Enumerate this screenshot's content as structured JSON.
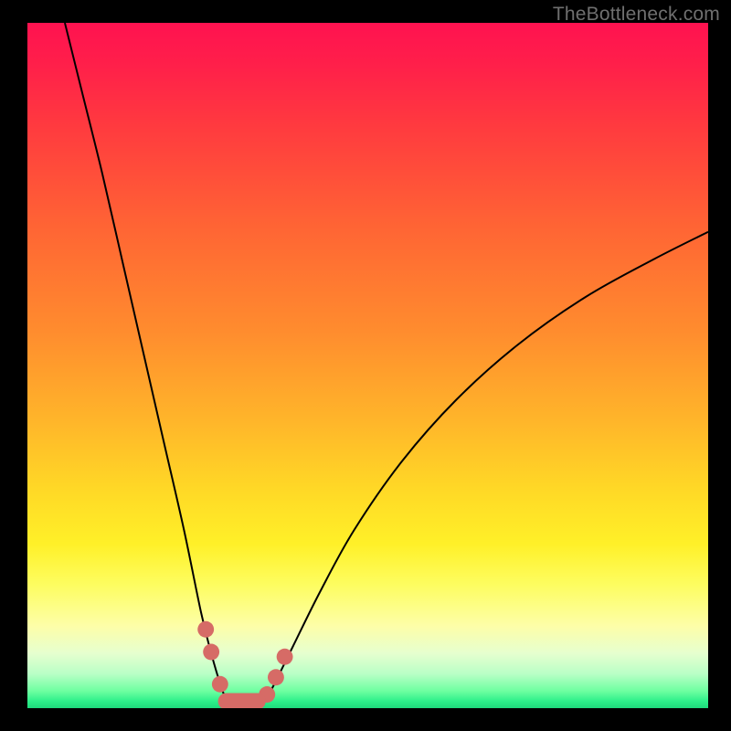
{
  "watermark": "TheBottleneck.com",
  "colors": {
    "background_frame": "#000000",
    "gradient_top": "#ff1250",
    "gradient_mid": "#ffd826",
    "gradient_bottom": "#1ed97c",
    "curve_stroke": "#000000",
    "marker_fill": "#d66b66"
  },
  "chart_data": {
    "type": "line",
    "title": "",
    "xlabel": "",
    "ylabel": "",
    "description": "Bottleneck V-curve: two branches descending to a flat minimum near x≈0.31 on [0,1] horizontal, y in [0,1] where 0 is bottom (zero bottleneck) and 1 is top (max bottleneck). Background color gradient encodes severity (red high → green low).",
    "x_range": [
      0,
      1
    ],
    "y_range": [
      0,
      1
    ],
    "series": [
      {
        "name": "left-branch",
        "x": [
          0.055,
          0.08,
          0.11,
          0.14,
          0.17,
          0.2,
          0.23,
          0.255,
          0.27,
          0.285,
          0.295
        ],
        "y": [
          1.0,
          0.9,
          0.78,
          0.65,
          0.52,
          0.39,
          0.26,
          0.14,
          0.08,
          0.03,
          0.005
        ]
      },
      {
        "name": "right-branch",
        "x": [
          0.345,
          0.36,
          0.39,
          0.43,
          0.48,
          0.55,
          0.63,
          0.72,
          0.82,
          0.92,
          1.0
        ],
        "y": [
          0.005,
          0.03,
          0.09,
          0.17,
          0.26,
          0.36,
          0.45,
          0.53,
          0.6,
          0.655,
          0.695
        ]
      },
      {
        "name": "floor",
        "x": [
          0.295,
          0.345
        ],
        "y": [
          0.005,
          0.005
        ]
      }
    ],
    "markers": {
      "name": "highlighted-points",
      "points": [
        {
          "x": 0.262,
          "y": 0.115
        },
        {
          "x": 0.27,
          "y": 0.082
        },
        {
          "x": 0.283,
          "y": 0.035
        },
        {
          "x": 0.352,
          "y": 0.02
        },
        {
          "x": 0.365,
          "y": 0.045
        },
        {
          "x": 0.378,
          "y": 0.075
        }
      ],
      "radius_frac": 0.012
    },
    "floor_bar": {
      "x0": 0.28,
      "x1": 0.35,
      "y": 0.01,
      "height_frac": 0.024
    }
  }
}
